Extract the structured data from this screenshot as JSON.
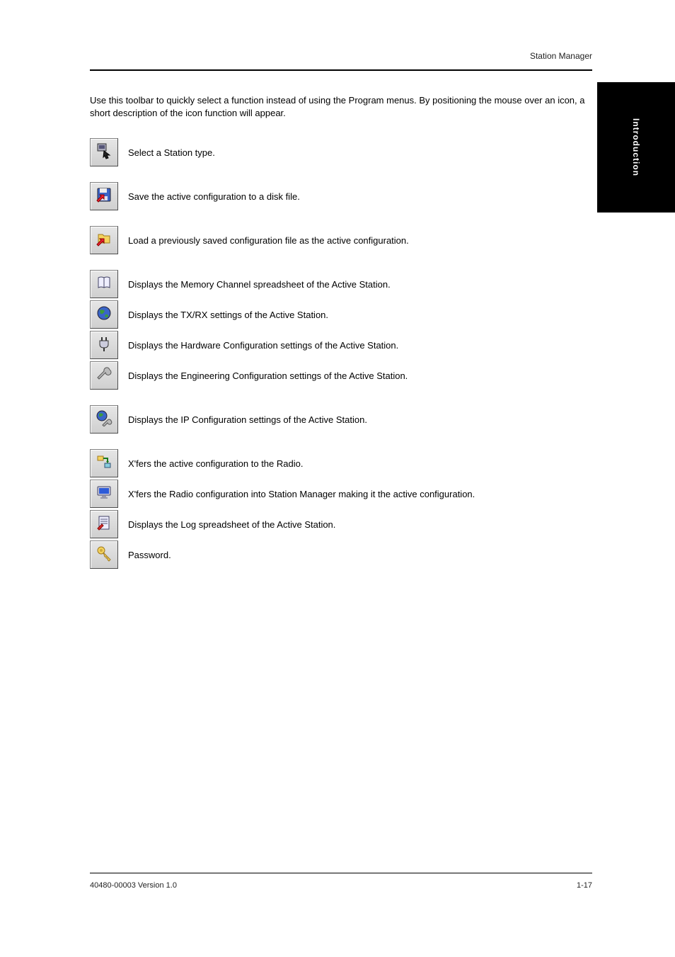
{
  "header": {
    "left": "",
    "right": "Station Manager"
  },
  "side_tab": "Introduction",
  "intro": "Use this toolbar to quickly select a function instead of using the Program menus. By positioning the mouse over an icon, a short description of the icon function will appear.",
  "buttons": [
    {
      "name": "select-station-button",
      "label": "Select a Station type."
    },
    {
      "name": "save-config-button",
      "label": "Save the active configuration to a disk file."
    },
    {
      "name": "load-config-button",
      "label": "Load a previously saved configuration file as the active configuration."
    },
    {
      "name": "memory-channels-button",
      "label": "Displays the Memory Channel spreadsheet of the Active Station."
    },
    {
      "name": "tx-rx-settings-button",
      "label": "Displays the TX/RX settings of the Active Station."
    },
    {
      "name": "hardware-config-button",
      "label": "Displays the Hardware Configuration settings of the Active Station."
    },
    {
      "name": "engineering-config-button",
      "label": "Displays the Engineering Configuration settings of the Active Station."
    },
    {
      "name": "ip-config-button",
      "label": "Displays the IP Configuration settings of the Active Station."
    },
    {
      "name": "xfer-to-radio-button",
      "label": "X'fers the active configuration to the Radio."
    },
    {
      "name": "xfer-from-radio-button",
      "label": "X'fers the Radio configuration into Station Manager making it the active configuration."
    },
    {
      "name": "log-spreadsheet-button",
      "label": "Displays the Log spreadsheet of the Active Station."
    },
    {
      "name": "password-button",
      "label": "Password."
    }
  ],
  "spacing": {
    "spaced_after_indices": [
      0,
      1,
      2,
      6,
      7
    ],
    "short_after_indices": [
      3,
      4,
      5,
      8,
      9,
      10
    ]
  },
  "footer": {
    "left": "40480-00003 Version 1.0",
    "right": "1-17"
  }
}
